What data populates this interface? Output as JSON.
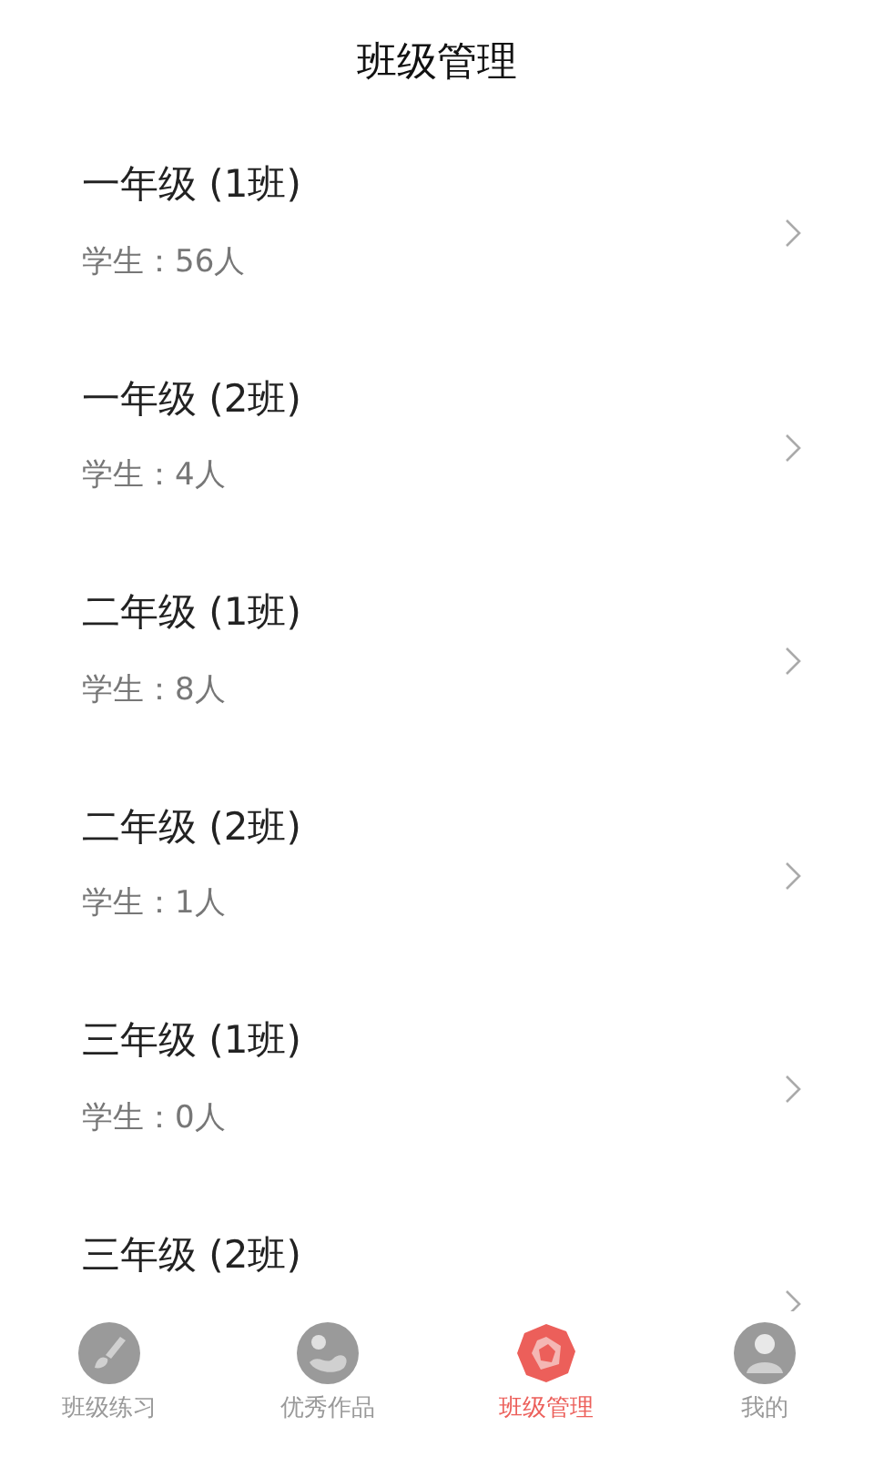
{
  "header": {
    "title": "班级管理"
  },
  "classes": [
    {
      "name": "一年级 (1班)",
      "students": "学生：56人"
    },
    {
      "name": "一年级 (2班)",
      "students": "学生：4人"
    },
    {
      "name": "二年级 (1班)",
      "students": "学生：8人"
    },
    {
      "name": "二年级 (2班)",
      "students": "学生：1人"
    },
    {
      "name": "三年级 (1班)",
      "students": "学生：0人"
    },
    {
      "name": "三年级 (2班)"
    }
  ],
  "tab_bar": [
    {
      "label": "班级练习",
      "kind": "brush",
      "selected": false
    },
    {
      "label": "优秀作品",
      "kind": "gallery",
      "selected": false
    },
    {
      "label": "班级管理",
      "kind": "polygon",
      "selected": true
    },
    {
      "label": "我的",
      "kind": "person",
      "selected": false
    }
  ]
}
